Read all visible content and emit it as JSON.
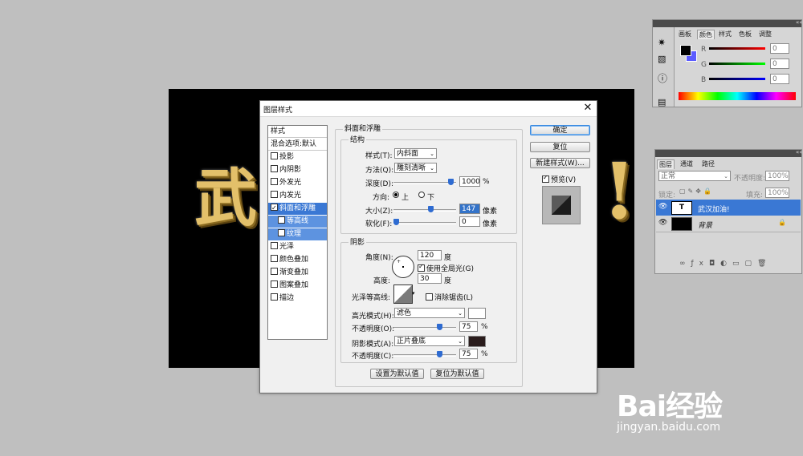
{
  "canvas": {
    "text_left": "武",
    "text_right": "!"
  },
  "dialog": {
    "title": "图层样式",
    "close": "✕",
    "style_list": {
      "header": "样式",
      "blend_options": "混合选项:默认",
      "items": [
        {
          "label": "投影",
          "checked": false
        },
        {
          "label": "内阴影",
          "checked": false
        },
        {
          "label": "外发光",
          "checked": false
        },
        {
          "label": "内发光",
          "checked": false
        },
        {
          "label": "斜面和浮雕",
          "checked": true
        },
        {
          "label": "等高线",
          "checked": false
        },
        {
          "label": "纹理",
          "checked": false
        },
        {
          "label": "光泽",
          "checked": false
        },
        {
          "label": "颜色叠加",
          "checked": false
        },
        {
          "label": "渐变叠加",
          "checked": false
        },
        {
          "label": "图案叠加",
          "checked": false
        },
        {
          "label": "描边",
          "checked": false
        }
      ]
    },
    "bevel": {
      "title": "斜面和浮雕",
      "structure": {
        "title": "结构",
        "style_label": "样式(T):",
        "style_value": "内斜面",
        "technique_label": "方法(Q):",
        "technique_value": "雕刻清晰",
        "depth_label": "深度(D):",
        "depth_value": "1000",
        "depth_unit": "%",
        "depth_level": 0.95,
        "direction_label": "方向:",
        "dir_up": "上",
        "dir_down": "下",
        "size_label": "大小(Z):",
        "size_value": "147",
        "size_unit": "像素",
        "size_level": 0.6,
        "soften_label": "软化(F):",
        "soften_value": "0",
        "soften_unit": "像素",
        "soften_level": 0.0
      },
      "shading": {
        "title": "阴影",
        "angle_label": "角度(N):",
        "angle_value": "120",
        "angle_unit": "度",
        "global_light": "使用全局光(G)",
        "altitude_label": "高度:",
        "altitude_value": "30",
        "altitude_unit": "度",
        "gloss_contour_label": "光泽等高线:",
        "anti_aliased": "消除锯齿(L)",
        "highlight_mode_label": "高光模式(H):",
        "highlight_mode": "滤色",
        "highlight_color": "#ffffff",
        "hl_opacity_label": "不透明度(O):",
        "hl_opacity": "75",
        "hl_opacity_level": 0.75,
        "shadow_mode_label": "阴影模式(A):",
        "shadow_mode": "正片叠底",
        "shadow_color": "#2a1c1c",
        "sh_opacity_label": "不透明度(C):",
        "sh_opacity": "75",
        "sh_opacity_level": 0.75,
        "pct": "%"
      },
      "set_default": "设置为默认值",
      "reset_default": "复位为默认值"
    },
    "buttons": {
      "ok": "确定",
      "reset": "复位",
      "new_style": "新建样式(W)...",
      "preview": "预览(V)"
    }
  },
  "color_panel": {
    "tabs": [
      "画板",
      "颜色",
      "样式",
      "色板",
      "调整"
    ],
    "active_tab": "颜色",
    "r": {
      "label": "R",
      "value": "0"
    },
    "g": {
      "label": "G",
      "value": "0"
    },
    "b": {
      "label": "B",
      "value": "0"
    }
  },
  "layers_panel": {
    "tabs": [
      "图层",
      "通道",
      "路径"
    ],
    "blend_mode": "正常",
    "opacity_label": "不透明度:",
    "opacity_value": "100%",
    "lock_label": "锁定:",
    "fill_label": "填充:",
    "fill_value": "100%",
    "layers": [
      {
        "name": "武汉加油!",
        "type": "T"
      },
      {
        "name": "背景",
        "type": "bg"
      }
    ]
  },
  "watermark": {
    "logo": "Bai经验",
    "url": "jingyan.baidu.com"
  }
}
